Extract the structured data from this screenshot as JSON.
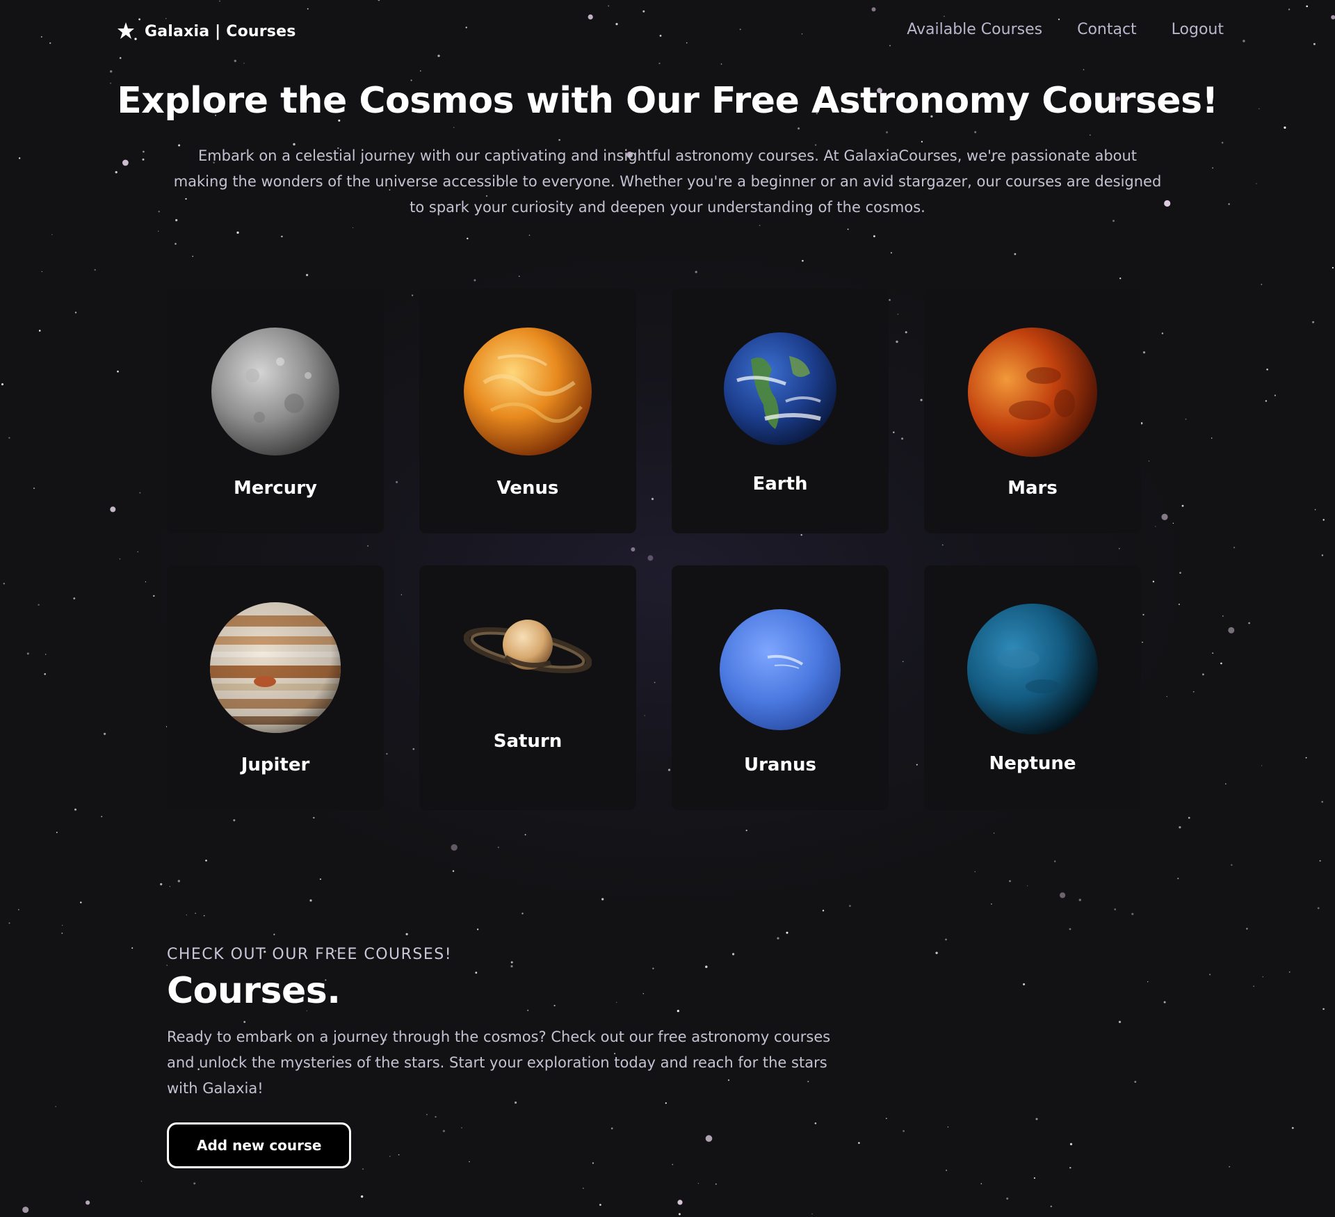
{
  "nav": {
    "brand": "Galaxia | Courses",
    "brand_icon": "star-icon",
    "links": [
      "Available Courses",
      "Contact",
      "Logout"
    ]
  },
  "hero": {
    "title": "Explore the Cosmos with Our Free Astronomy Courses!",
    "subtitle": "Embark on a celestial journey with our captivating and insightful astronomy courses. At GalaxiaCourses, we're passionate about making the wonders of the universe accessible to everyone. Whether you're a beginner or an avid stargazer, our courses are designed to spark your curiosity and deepen your understanding of the cosmos."
  },
  "planets": [
    {
      "name": "Mercury",
      "icon": "mercury-planet-icon"
    },
    {
      "name": "Venus",
      "icon": "venus-planet-icon"
    },
    {
      "name": "Earth",
      "icon": "earth-planet-icon"
    },
    {
      "name": "Mars",
      "icon": "mars-planet-icon"
    },
    {
      "name": "Jupiter",
      "icon": "jupiter-planet-icon"
    },
    {
      "name": "Saturn",
      "icon": "saturn-planet-icon"
    },
    {
      "name": "Uranus",
      "icon": "uranus-planet-icon"
    },
    {
      "name": "Neptune",
      "icon": "neptune-planet-icon"
    }
  ],
  "courses": {
    "eyebrow": "CHECK OUT OUR FREE COURSES!",
    "title": "Courses.",
    "text": "Ready to embark on a journey through the cosmos? Check out our free astronomy courses and unlock the mysteries of the stars. Start your exploration today and reach for the stars with Galaxia!",
    "button": "Add new course"
  },
  "colors": {
    "background": "#121214",
    "card": "#111113",
    "muted_text": "#c4c2d2",
    "nav_link": "#b9b6cc"
  }
}
